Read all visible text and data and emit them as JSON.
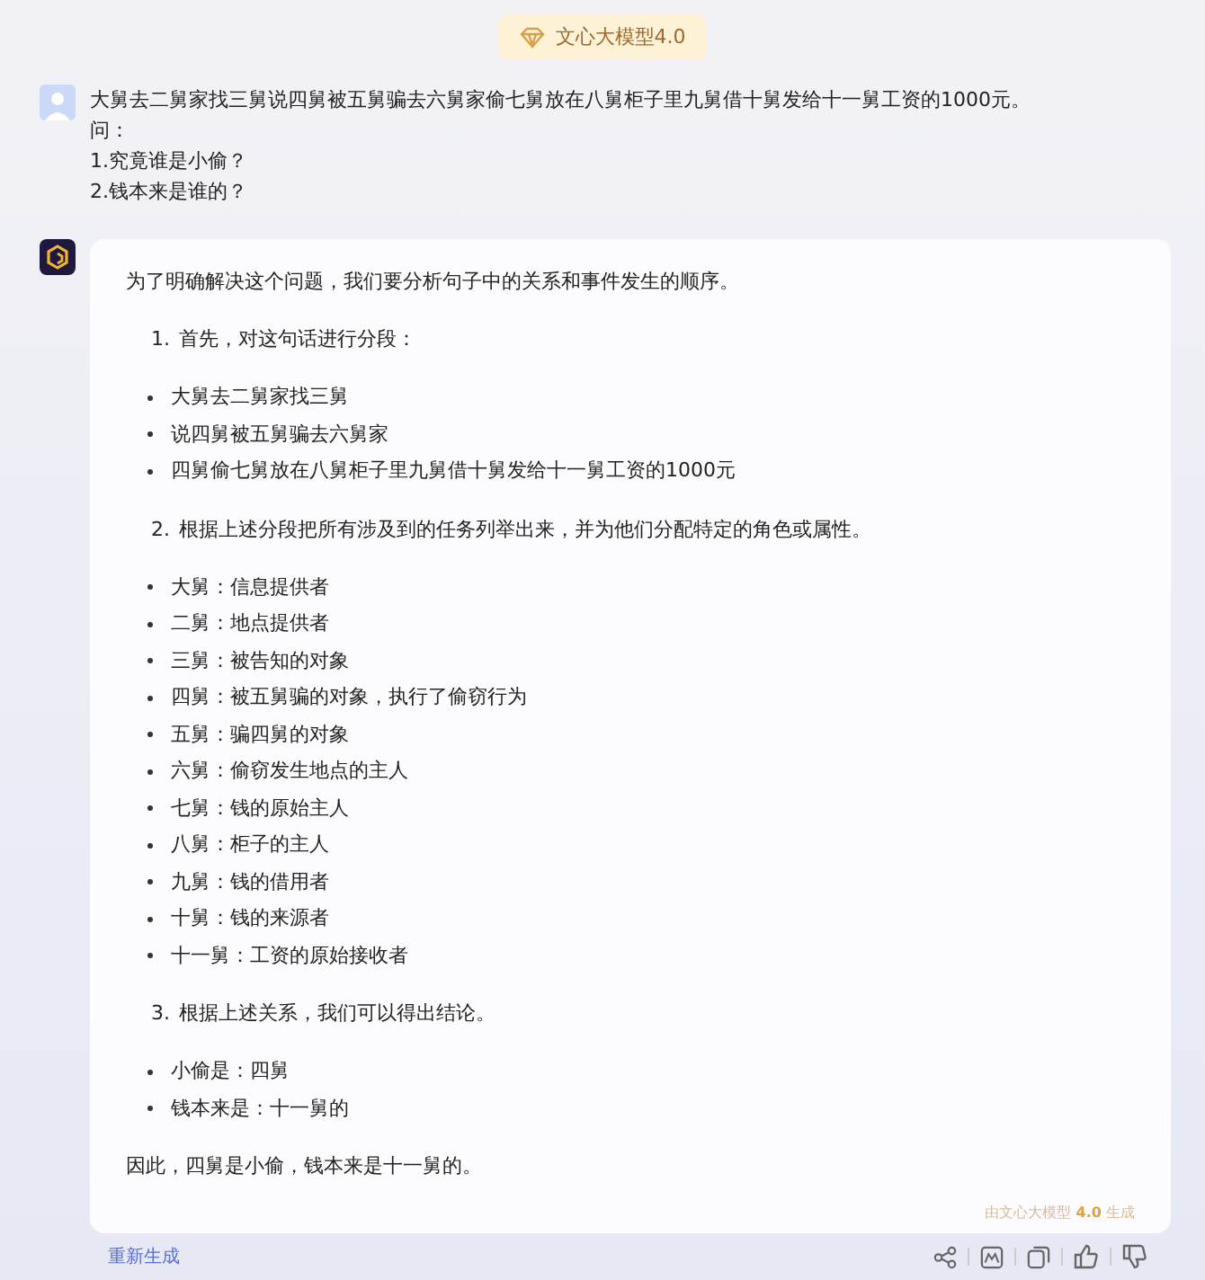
{
  "model_badge": {
    "label": "文心大模型4.0"
  },
  "user_message": {
    "lines": [
      "大舅去二舅家找三舅说四舅被五舅骗去六舅家偷七舅放在八舅柜子里九舅借十舅发给十一舅工资的1000元。",
      "问：",
      "1.究竟谁是小偷？",
      "2.钱本来是谁的？"
    ]
  },
  "answer": {
    "blocks": [
      {
        "kind": "paragraph",
        "text": "为了明确解决这个问题，我们要分析句子中的关系和事件发生的顺序。"
      },
      {
        "kind": "numbered",
        "number": "1.",
        "text": "首先，对这句话进行分段："
      },
      {
        "kind": "bullets",
        "items": [
          "大舅去二舅家找三舅",
          "说四舅被五舅骗去六舅家",
          "四舅偷七舅放在八舅柜子里九舅借十舅发给十一舅工资的1000元"
        ]
      },
      {
        "kind": "numbered",
        "number": "2.",
        "text": "根据上述分段把所有涉及到的任务列举出来，并为他们分配特定的角色或属性。"
      },
      {
        "kind": "bullets",
        "items": [
          "大舅：信息提供者",
          "二舅：地点提供者",
          "三舅：被告知的对象",
          "四舅：被五舅骗的对象，执行了偷窃行为",
          "五舅：骗四舅的对象",
          "六舅：偷窃发生地点的主人",
          "七舅：钱的原始主人",
          "八舅：柜子的主人",
          "九舅：钱的借用者",
          "十舅：钱的来源者",
          "十一舅：工资的原始接收者"
        ]
      },
      {
        "kind": "numbered",
        "number": "3.",
        "text": "根据上述关系，我们可以得出结论。"
      },
      {
        "kind": "bullets",
        "items": [
          "小偷是：四舅",
          "钱本来是：十一舅的"
        ]
      },
      {
        "kind": "paragraph",
        "text": "因此，四舅是小偷，钱本来是十一舅的。"
      }
    ],
    "footer_note": "由文心大模型 **4.0** 生成"
  },
  "regenerate": "重新生成"
}
